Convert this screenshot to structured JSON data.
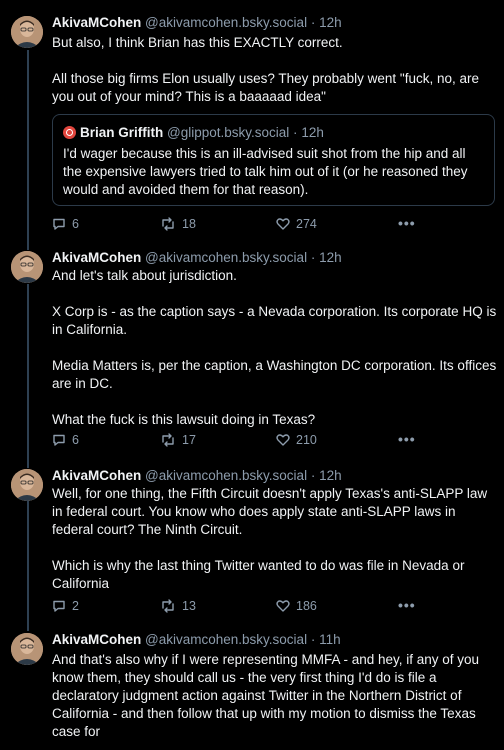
{
  "posts": [
    {
      "author": "AkivaMCohen",
      "handle": "@akivamcohen.bsky.social",
      "time": "12h",
      "text": "But also, I think Brian has this EXACTLY correct.\n\nAll those big firms Elon usually uses? They probably went \"fuck, no, are you out of your mind? This is a baaaaad idea\"",
      "quote": {
        "author": "Brian Griffith",
        "handle": "@glippot.bsky.social",
        "time": "12h",
        "text": "I'd wager because this is an ill-advised suit shot from the hip and all the expensive lawyers tried to talk him out of it (or he reasoned they would and avoided them for that reason)."
      },
      "replies": "6",
      "reposts": "18",
      "likes": "274"
    },
    {
      "author": "AkivaMCohen",
      "handle": "@akivamcohen.bsky.social",
      "time": "12h",
      "text": "And let's talk about jurisdiction.\n\nX Corp is - as the caption says - a Nevada corporation. Its corporate HQ is in California.\n\nMedia Matters is, per the caption, a Washington DC corporation. Its offices are in DC.\n\nWhat the fuck is this lawsuit doing in Texas?",
      "replies": "6",
      "reposts": "17",
      "likes": "210"
    },
    {
      "author": "AkivaMCohen",
      "handle": "@akivamcohen.bsky.social",
      "time": "12h",
      "text": "Well, for one thing, the Fifth Circuit doesn't apply Texas's anti-SLAPP law in federal court. You know who does apply state anti-SLAPP laws in federal court? The Ninth Circuit.\n\nWhich is why the last thing Twitter wanted to do was file in Nevada or California",
      "replies": "2",
      "reposts": "13",
      "likes": "186"
    },
    {
      "author": "AkivaMCohen",
      "handle": "@akivamcohen.bsky.social",
      "time": "11h",
      "text": "And that's also why if I were representing MMFA - and hey, if any of you know them, they should call us - the very first thing I'd do is file a declaratory judgment action against Twitter in the Northern District of California - and then follow that up with my motion to dismiss the Texas case for"
    }
  ],
  "dot": "·",
  "more_glyph": "•••",
  "colors": {
    "background": "#000000",
    "text": "#f1f3f5",
    "muted": "#8d9cac",
    "thread_line": "#2e4052"
  }
}
